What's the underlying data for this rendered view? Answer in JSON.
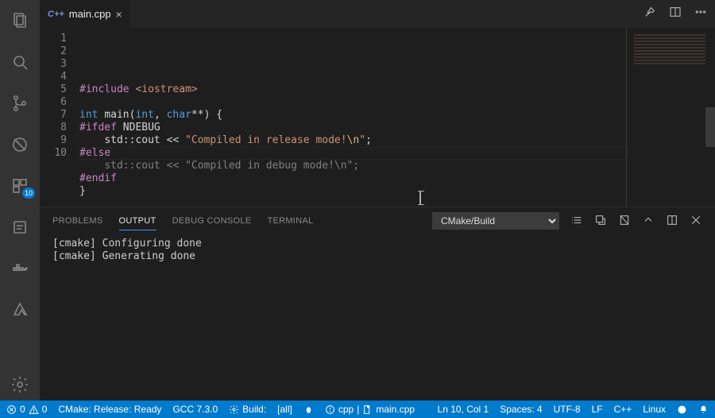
{
  "tab": {
    "icon_label": "C++",
    "filename": "main.cpp"
  },
  "activity": {
    "badge_count": "10"
  },
  "code": {
    "lines": [
      [
        [
          "tok-pp",
          "#include "
        ],
        [
          "tok-inc",
          "<iostream>"
        ]
      ],
      [
        [
          "",
          ""
        ]
      ],
      [
        [
          "tok-kw",
          "int "
        ],
        [
          "tok-id",
          "main"
        ],
        [
          "tok-pun",
          "("
        ],
        [
          "tok-ty",
          "int"
        ],
        [
          "tok-pun",
          ", "
        ],
        [
          "tok-ty",
          "char"
        ],
        [
          "tok-pun",
          "**"
        ],
        [
          "tok-pun",
          ") {"
        ]
      ],
      [
        [
          "tok-pp",
          "#ifdef "
        ],
        [
          "tok-id",
          "NDEBUG"
        ]
      ],
      [
        [
          "tok-dim",
          "    "
        ],
        [
          "tok-id",
          "std"
        ],
        [
          "tok-pun",
          "::"
        ],
        [
          "tok-id",
          "cout"
        ],
        [
          "tok-pun",
          " << "
        ],
        [
          "tok-str",
          "\"Compiled in release mode!"
        ],
        [
          "tok-esc",
          "\\n"
        ],
        [
          "tok-str",
          "\""
        ],
        [
          "tok-pun",
          ";"
        ]
      ],
      [
        [
          "tok-pp",
          "#else"
        ]
      ],
      [
        [
          "tok-dim",
          "    "
        ],
        [
          "tok-dim",
          "std::cout << "
        ],
        [
          "tok-dim",
          "\"Compiled in debug mode!\\n\""
        ],
        [
          "tok-dim",
          ";"
        ]
      ],
      [
        [
          "tok-pp",
          "#endif"
        ]
      ],
      [
        [
          "tok-pun",
          "}"
        ]
      ],
      [
        [
          "",
          ""
        ]
      ]
    ]
  },
  "panel": {
    "tabs": {
      "problems": "PROBLEMS",
      "output": "OUTPUT",
      "debug": "DEBUG CONSOLE",
      "terminal": "TERMINAL"
    },
    "select": {
      "value": "CMake/Build"
    },
    "output_lines": [
      "[cmake] Configuring done",
      "[cmake] Generating done"
    ]
  },
  "status": {
    "errors": "0",
    "warnings": "0",
    "cmake": "CMake: Release: Ready",
    "gcc": "GCC 7.3.0",
    "build": "Build:",
    "target": "[all]",
    "ctx_cpp": "cpp",
    "ctx_file": "main.cpp",
    "position": "Ln 10, Col 1",
    "spaces": "Spaces: 4",
    "encoding": "UTF-8",
    "eol": "LF",
    "lang": "C++",
    "platform": "Linux"
  }
}
